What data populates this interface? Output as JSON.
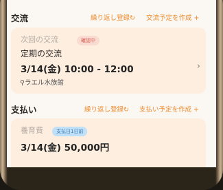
{
  "exchange": {
    "title": "交流",
    "repeat_label": "繰り返し登録",
    "create_label": "交流予定を作成",
    "card": {
      "label": "次回の交流",
      "badge": "確認中",
      "event_title": "定期の交流",
      "datetime": "3/14(金) 10:00 - 12:00",
      "location": "ラエル水族館"
    }
  },
  "payment": {
    "title": "支払い",
    "repeat_label": "繰り返し登録",
    "create_label": "支払い予定を作成",
    "card": {
      "label": "養育費",
      "badge": "支払日1日前",
      "date_amount": "3/14(金)  50,000円"
    }
  },
  "colors": {
    "accent": "#ec8a2d",
    "card_bg": "#fdeee0",
    "screen_bg": "#fbf8f3"
  },
  "icons": {
    "repeat": "refresh-icon",
    "plus": "plus-icon",
    "chevron": "chevron-right-icon",
    "location": "pin-icon"
  }
}
